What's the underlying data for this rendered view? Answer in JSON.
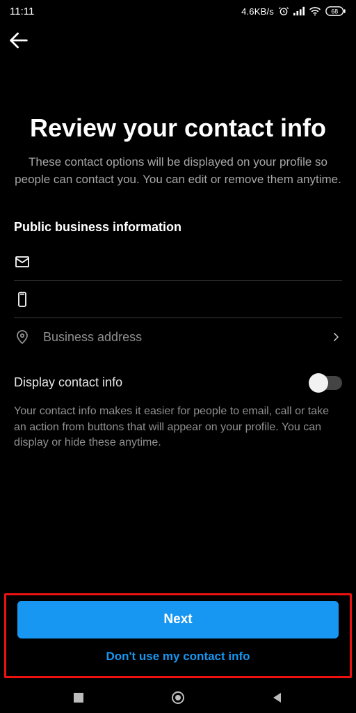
{
  "statusbar": {
    "time": "11:11",
    "speed": "4.6KB/s",
    "battery": "68"
  },
  "header": {
    "title": "Review your contact info",
    "subtitle": "These contact options will be displayed on your profile so people can contact you. You can edit or remove them anytime."
  },
  "section": {
    "label": "Public business information",
    "fields": {
      "email_placeholder": "",
      "phone_placeholder": "",
      "address_label": "Business address"
    }
  },
  "display_toggle": {
    "label": "Display contact info",
    "helper": "Your contact info makes it easier for people to email, call or take an action from buttons that will appear on your profile. You can display or hide these anytime."
  },
  "actions": {
    "primary": "Next",
    "secondary": "Don't use my contact info"
  }
}
